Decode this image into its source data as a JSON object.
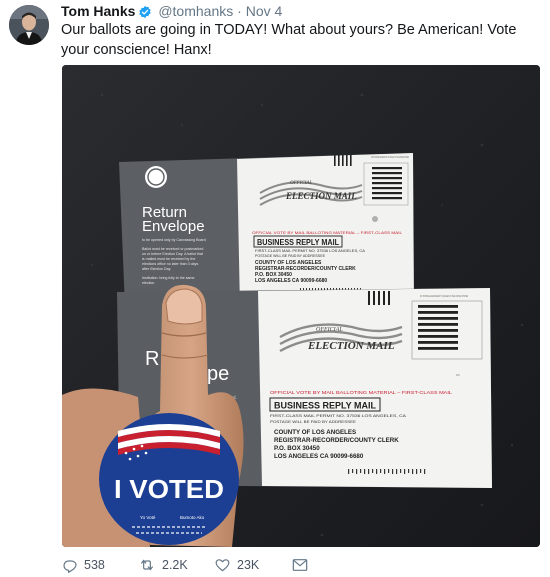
{
  "tweet": {
    "author_name": "Tom Hanks",
    "handle": "@tomhanks",
    "separator": "·",
    "date": "Nov 4",
    "text": "Our ballots are going in TODAY!  What about yours?  Be American!  Vote your conscience!  Hanx!"
  },
  "photo": {
    "back_envelope": {
      "title_line1": "Return",
      "title_line2": "Envelope",
      "small_line1": "to be opened only by Canvassing Board",
      "small_line2": "Ballot must be received or postmarked",
      "small_line3": "on or before Election Day. A ballot that",
      "small_line4": "is mailed must be received by the",
      "small_line5": "elections office no later than 3 days",
      "small_line6": "after Election Day.",
      "small_line7": "Institution: bring fully to the same",
      "small_line8": "election",
      "official_word": "OFFICIAL",
      "election_mail": "ELECTION MAIL",
      "official_strip": "OFFICIAL VOTE BY MAIL BALLOTING MATERIAL – FIRST-CLASS MAIL",
      "brm": "BUSINESS REPLY MAIL",
      "permit_line": "FIRST-CLASS MAIL  PERMIT NO. 37536  LOS ANGELES, CA",
      "postage_line": "POSTAGE WILL BE PAID BY ADDRESSEE",
      "address_line1": "COUNTY OF LOS ANGELES",
      "address_line2": "REGISTRAR-RECORDER/COUNTY CLERK",
      "address_line3": "P.O. BOX 30450",
      "address_line4": "LOS ANGELES CA 90099-6680",
      "stamp_text": "NO POSTAGE NECESSARY IF MAILED IN THE UNITED STATES"
    },
    "front_envelope": {
      "title_fragment1": "R",
      "title_fragment2": "pe",
      "small_line1": "anvassing Board.",
      "small_line2": "postmarked",
      "small_line3": "a ballot that",
      "small_line4": "by the",
      "small_line5": "n 3 days",
      "small_line6": "same",
      "official_word": "OFFICIAL",
      "election_mail": "ELECTION MAIL",
      "official_strip": "OFFICIAL VOTE BY MAIL BALLOTING MATERIAL – FIRST-CLASS MAIL",
      "brm": "BUSINESS REPLY MAIL",
      "permit_line": "FIRST-CLASS MAIL  PERMIT NO. 37536  LOS ANGELES, CA",
      "postage_line": "POSTAGE WILL BE PAID BY ADDRESSEE",
      "address_line1": "COUNTY OF LOS ANGELES",
      "address_line2": "REGISTRAR-RECORDER/COUNTY CLERK",
      "address_line3": "P.O. BOX 30450",
      "address_line4": "LOS ANGELES CA 90099-6680",
      "stamp_text": "NO POSTAGE NECESSARY IF MAILED IN THE UNITED STATES"
    },
    "sticker": {
      "text": "I VOTED",
      "small_line1": "Yo Voté",
      "small_line2": "Bumoto Ako"
    }
  },
  "actions": {
    "replies": "538",
    "retweets": "2.2K",
    "likes": "23K"
  },
  "colors": {
    "verified": "#1da1f2",
    "text": "#14171a",
    "secondary": "#657786",
    "countertop": "#1e2024",
    "envelope_dark": "#5a5d62",
    "envelope_white": "#f3f3f1",
    "sticker_blue": "#1c3f94",
    "sticker_red": "#c8202f"
  },
  "icons": [
    "verified-badge-icon",
    "reply-icon",
    "retweet-icon",
    "like-icon",
    "message-icon"
  ]
}
